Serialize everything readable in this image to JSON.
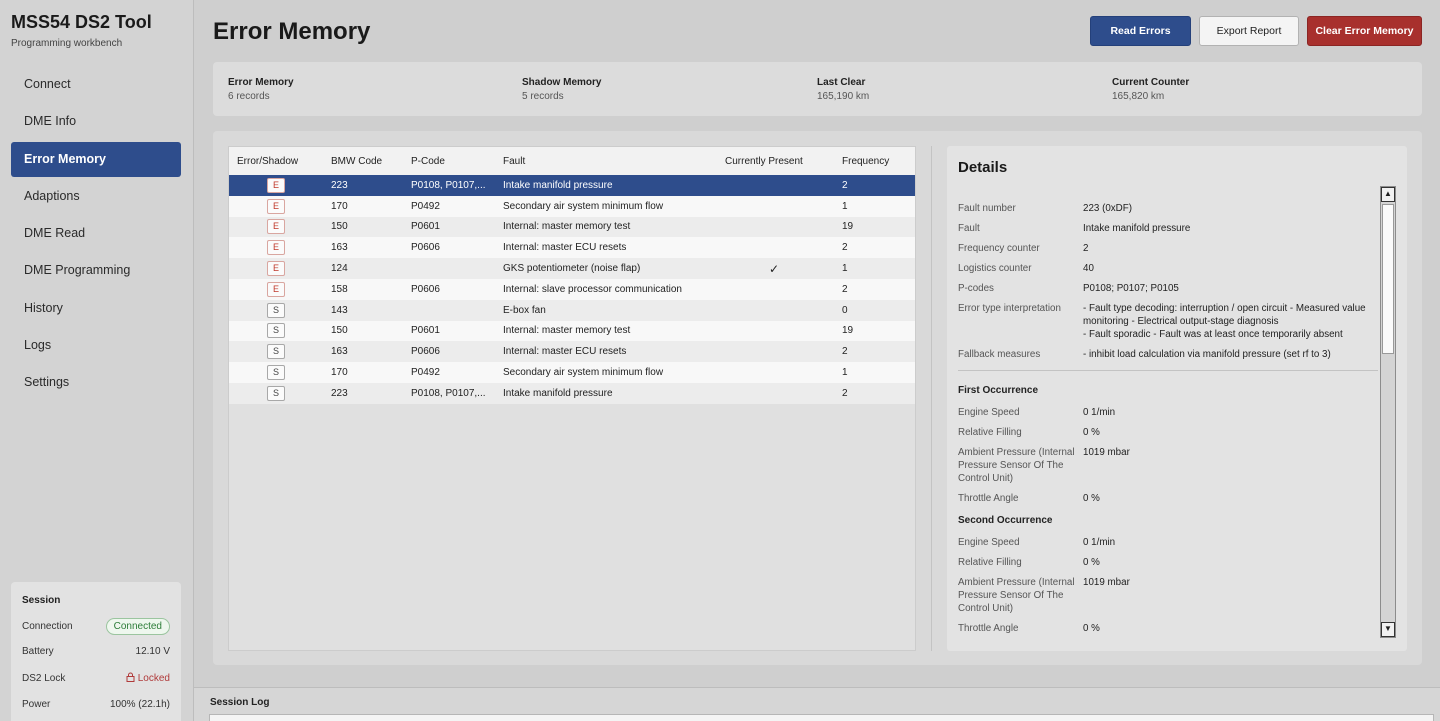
{
  "app": {
    "title": "MSS54 DS2 Tool",
    "subtitle": "Programming workbench"
  },
  "nav": [
    {
      "label": "Connect",
      "active": false
    },
    {
      "label": "DME Info",
      "active": false
    },
    {
      "label": "Error Memory",
      "active": true
    },
    {
      "label": "Adaptions",
      "active": false
    },
    {
      "label": "DME Read",
      "active": false
    },
    {
      "label": "DME Programming",
      "active": false
    },
    {
      "label": "History",
      "active": false
    },
    {
      "label": "Logs",
      "active": false
    },
    {
      "label": "Settings",
      "active": false
    }
  ],
  "session": {
    "title": "Session",
    "rows": [
      {
        "label": "Connection",
        "value": "Connected"
      },
      {
        "label": "Battery",
        "value": "12.10 V"
      },
      {
        "label": "DS2 Lock",
        "value": "Locked"
      },
      {
        "label": "Power",
        "value": "100% (22.1h)"
      }
    ]
  },
  "page": {
    "title": "Error Memory"
  },
  "toolbar": {
    "read": "Read Errors",
    "export": "Export Report",
    "clear": "Clear Error Memory"
  },
  "stats": [
    {
      "label": "Error Memory",
      "value": "6 records"
    },
    {
      "label": "Shadow Memory",
      "value": "5 records"
    },
    {
      "label": "Last Clear",
      "value": "165,190 km"
    },
    {
      "label": "Current Counter",
      "value": "165,820 km"
    }
  ],
  "table": {
    "headers": [
      "Error/Shadow",
      "BMW Code",
      "P-Code",
      "Fault",
      "Currently Present",
      "Frequency"
    ],
    "rows": [
      {
        "type": "E",
        "bmw": "223",
        "pcode": "P0108, P0107,...",
        "fault": "Intake manifold pressure",
        "present": "",
        "freq": "2"
      },
      {
        "type": "E",
        "bmw": "170",
        "pcode": "P0492",
        "fault": "Secondary air system minimum flow",
        "present": "",
        "freq": "1"
      },
      {
        "type": "E",
        "bmw": "150",
        "pcode": "P0601",
        "fault": "Internal: master memory test",
        "present": "",
        "freq": "19"
      },
      {
        "type": "E",
        "bmw": "163",
        "pcode": "P0606",
        "fault": "Internal: master ECU resets",
        "present": "",
        "freq": "2"
      },
      {
        "type": "E",
        "bmw": "124",
        "pcode": "",
        "fault": "GKS potentiometer (noise flap)",
        "present": "✓",
        "freq": "1"
      },
      {
        "type": "E",
        "bmw": "158",
        "pcode": "P0606",
        "fault": "Internal: slave processor communication",
        "present": "",
        "freq": "2"
      },
      {
        "type": "S",
        "bmw": "143",
        "pcode": "",
        "fault": "E-box fan",
        "present": "",
        "freq": "0"
      },
      {
        "type": "S",
        "bmw": "150",
        "pcode": "P0601",
        "fault": "Internal: master memory test",
        "present": "",
        "freq": "19"
      },
      {
        "type": "S",
        "bmw": "163",
        "pcode": "P0606",
        "fault": "Internal: master ECU resets",
        "present": "",
        "freq": "2"
      },
      {
        "type": "S",
        "bmw": "170",
        "pcode": "P0492",
        "fault": "Secondary air system minimum flow",
        "present": "",
        "freq": "1"
      },
      {
        "type": "S",
        "bmw": "223",
        "pcode": "P0108, P0107,...",
        "fault": "Intake manifold pressure",
        "present": "",
        "freq": "2"
      }
    ]
  },
  "details": {
    "title": "Details",
    "fields": [
      {
        "k": "Fault number",
        "v": "223 (0xDF)"
      },
      {
        "k": "Fault",
        "v": "Intake manifold pressure"
      },
      {
        "k": "Frequency counter",
        "v": "2"
      },
      {
        "k": "Logistics counter",
        "v": "40"
      },
      {
        "k": "P-codes",
        "v": "P0108; P0107; P0105"
      },
      {
        "k": "Error type interpretation",
        "v": "- Fault type decoding: interruption / open circuit - Measured value monitoring - Electrical output-stage diagnosis\n- Fault sporadic - Fault was at least once temporarily absent"
      },
      {
        "k": "Fallback measures",
        "v": "- inhibit load calculation via manifold pressure (set rf to 3)"
      }
    ],
    "first_title": "First Occurrence",
    "first": [
      {
        "k": "Engine Speed",
        "v": "0 1/min"
      },
      {
        "k": "Relative Filling",
        "v": "0 %"
      },
      {
        "k": "Ambient Pressure (Internal Pressure Sensor Of The Control Unit)",
        "v": "1019 mbar"
      },
      {
        "k": "Throttle Angle",
        "v": "0 %"
      }
    ],
    "second_title": "Second Occurrence",
    "second": [
      {
        "k": "Engine Speed",
        "v": "0 1/min"
      },
      {
        "k": "Relative Filling",
        "v": "0 %"
      },
      {
        "k": "Ambient Pressure (Internal Pressure Sensor Of The Control Unit)",
        "v": "1019 mbar"
      },
      {
        "k": "Throttle Angle",
        "v": "0 %"
      }
    ]
  },
  "log": {
    "title": "Session Log"
  },
  "colors": {
    "accent": "#2e4d8c",
    "danger": "#a8302d",
    "success": "#2d7d39"
  }
}
